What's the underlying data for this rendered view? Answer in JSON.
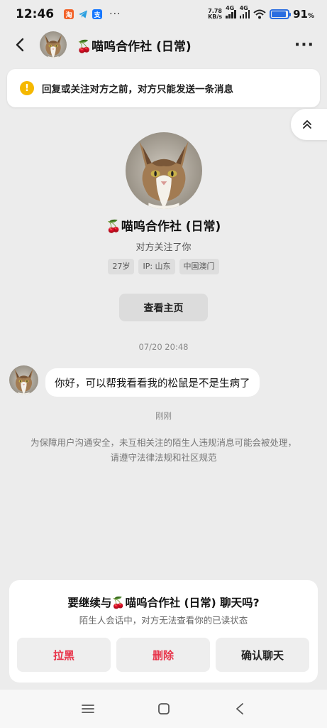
{
  "status_bar": {
    "time": "12:46",
    "dots": "···",
    "speed_value": "7.78",
    "speed_unit": "KB/s",
    "network1": "4G",
    "network2": "4G",
    "battery_level": 0.91,
    "battery_pct": "91",
    "battery_pct_sign": "%"
  },
  "header": {
    "title": "🍒喵呜合作社 (日常)",
    "more_label": "···"
  },
  "notice": {
    "icon_text": "!",
    "text": "回复或关注对方之前，对方只能发送一条消息"
  },
  "profile": {
    "name": "🍒喵呜合作社 (日常)",
    "subtitle": "对方关注了你",
    "tags": [
      "27岁",
      "IP: 山东",
      "中国澳门"
    ],
    "home_button": "查看主页"
  },
  "chat": {
    "timestamp": "07/20 20:48",
    "message": "你好，可以帮我看看我的松鼠是不是生病了",
    "message_time": "刚刚",
    "safety_notice": "为保障用户沟通安全，未互相关注的陌生人违规消息可能会被处理，请遵守法律法规和社区规范"
  },
  "sheet": {
    "title": "要继续与🍒喵呜合作社 (日常) 聊天吗?",
    "subtitle": "陌生人会话中，对方无法查看你的已读状态",
    "block_label": "拉黑",
    "delete_label": "删除",
    "confirm_label": "确认聊天"
  },
  "colors": {
    "accent_red": "#e8344a",
    "warning": "#f5b800",
    "background": "#ececec"
  },
  "icons": {
    "back": "chevron-left-icon",
    "scroll_up": "double-chevron-up-icon",
    "nav_menu": "menu-icon",
    "nav_home": "square-icon",
    "nav_back": "triangle-back-icon"
  }
}
